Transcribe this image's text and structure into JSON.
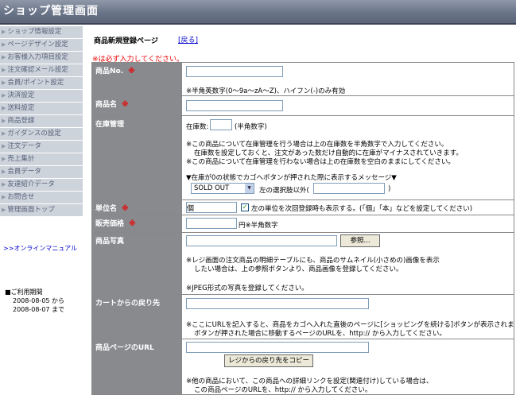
{
  "header": {
    "title": "ショップ管理画面"
  },
  "sidebar": {
    "items": [
      {
        "label": "ショップ情報設定"
      },
      {
        "label": "ページデザイン設定"
      },
      {
        "label": "お客様入力項目設定"
      },
      {
        "label": "注文確認メール設定"
      },
      {
        "label": "会員/ポイント設定"
      },
      {
        "label": "決済設定"
      },
      {
        "label": "送料設定"
      },
      {
        "label": "商品登録"
      },
      {
        "label": "ガイダンスの設定"
      },
      {
        "label": "注文データ"
      },
      {
        "label": "売上集計"
      },
      {
        "label": "会員データ"
      },
      {
        "label": "友達紹介データ"
      },
      {
        "label": "お問合せ"
      },
      {
        "label": "管理画面トップ"
      }
    ],
    "arrow": "▶",
    "manual_link": ">>オンラインマニュアル",
    "period": {
      "label": "■ご利用期間",
      "from": "2008-08-05 から",
      "to": "2008-08-07 まで"
    }
  },
  "main": {
    "title": "商品新規登録ページ",
    "back_link": "[戻る]",
    "required_note": "※は必ず入力してください。",
    "required_mark": "※",
    "rows": {
      "product_no": {
        "label": "商品No.",
        "note": "※半角英数字(0〜9a〜zA〜Z)、ハイフン(-)のみ有効",
        "value": ""
      },
      "product_name": {
        "label": "商品名",
        "value": ""
      },
      "stock": {
        "label": "在庫管理",
        "stock_label": "在庫数:",
        "stock_suffix": "(半角数字)",
        "note1": "※この商品について在庫管理を行う場合は上の在庫数を半角数字で入力してください。",
        "note2": "在庫数を設定しておくと、注文があった数だけ自動的に在庫がマイナスされていきます。",
        "note3": "※この商品について在庫管理を行わない場合は上の在庫数を空白のままにしてください。",
        "message_label": "▼在庫が0の状態でカゴへボタンが押された際に表示するメッセージ▼",
        "select_value": "SOLD OUT",
        "other_label": "左の選択肢以外(",
        "other_close": ")"
      },
      "unit": {
        "label": "単位名",
        "value": "個",
        "checkbox_label": "左の単位を次回登録時も表示する。(「個」「本」などを設定してください)",
        "checked": true
      },
      "price": {
        "label": "販売価格",
        "suffix": "円※半角数字",
        "value": ""
      },
      "photo": {
        "label": "商品写真",
        "browse_button": "参照...",
        "note1": "※レジ画面の注文商品の明細テーブルにも、商品のサムネイル(小さめの)画像を表示",
        "note2": "したい場合は、上の参照ボタンより、商品画像を登録してください。",
        "note3": "※JPEG形式の写真を登録してください。"
      },
      "return": {
        "label": "カートからの戻り先",
        "note1": "※ここにURLを記入すると、商品をカゴへ入れた直後のページに[ショッピングを続ける]ボタンが表示されます。",
        "note2": "ボタンが押された場合に移動するページのURLを、http:// から入力してください。"
      },
      "page_url": {
        "label": "商品ページのURL",
        "copy_button": "レジからの戻り先をコピー",
        "note1": "※他の商品において、この商品への詳細リンクを設定(関連付け)している場合は、",
        "note2": "この商品ページのURLを、http:// から入力してください。"
      }
    }
  },
  "colors": {
    "header": "#6a7488",
    "sidebar_bg": "#cdd3db",
    "label_bg": "#888a8e",
    "required": "#e00000",
    "link": "#0000cc"
  }
}
